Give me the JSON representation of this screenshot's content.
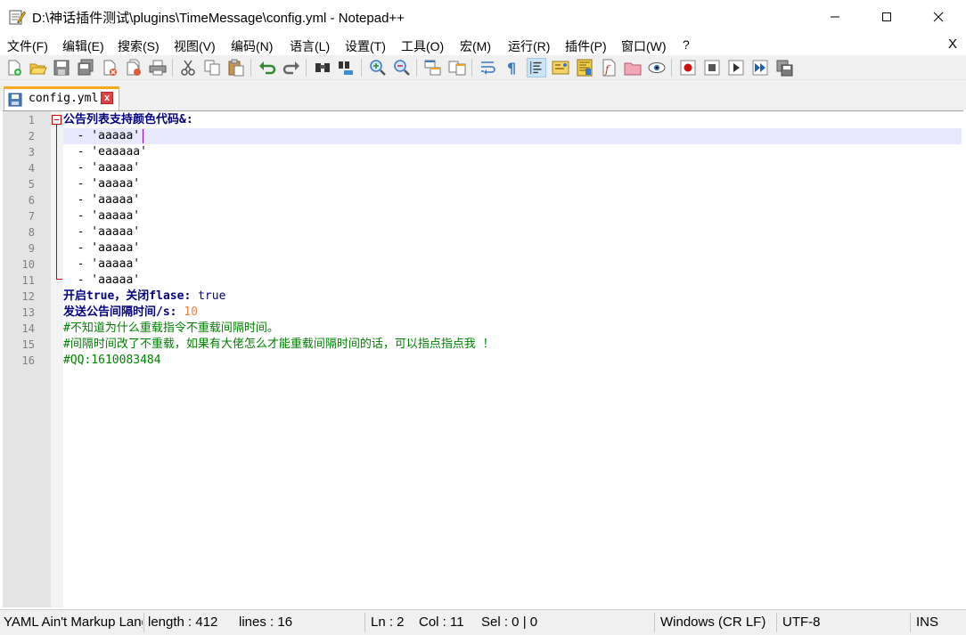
{
  "window": {
    "title": "D:\\神话插件测试\\plugins\\TimeMessage\\config.yml - Notepad++",
    "icon": "notepad-icon",
    "minimize_label": "─",
    "close_label": "✕"
  },
  "menu": {
    "items": [
      "文件(F)",
      "编辑(E)",
      "搜索(S)",
      "视图(V)",
      "编码(N)",
      "语言(L)",
      "设置(T)",
      "工具(O)",
      "宏(M)",
      "运行(R)",
      "插件(P)",
      "窗口(W)",
      "?"
    ],
    "close_label": "X"
  },
  "toolbar": {
    "icons": [
      "new-file-icon",
      "open-file-icon",
      "save-icon",
      "save-all-icon",
      "close-icon",
      "close-all-icon",
      "print-icon",
      "cut-icon",
      "copy-icon",
      "paste-icon",
      "undo-icon",
      "redo-icon",
      "find-icon",
      "replace-icon",
      "zoom-in-icon",
      "zoom-out-icon",
      "sync-vertical-icon",
      "sync-horizontal-icon",
      "word-wrap-icon",
      "show-all-chars-icon",
      "indent-guide-icon",
      "doc-map-icon",
      "function-list-icon",
      "folder-as-workspace-icon",
      "monitoring-icon",
      "record-macro-icon",
      "stop-record-icon",
      "play-macro-icon",
      "run-macro-multiple-icon",
      "save-macro-icon"
    ]
  },
  "tab": {
    "label": "config.yml",
    "close_label": "x"
  },
  "editor": {
    "lines": [
      {
        "num": "1",
        "parts": [
          {
            "cls": "k",
            "text": "公告列表支持颜色代码"
          },
          {
            "cls": "k",
            "text": "&:"
          }
        ]
      },
      {
        "num": "2",
        "parts": [
          {
            "cls": "s",
            "text": "  - 'aaaaa'"
          }
        ]
      },
      {
        "num": "3",
        "parts": [
          {
            "cls": "s",
            "text": "  - 'eaaaaa'"
          }
        ]
      },
      {
        "num": "4",
        "parts": [
          {
            "cls": "s",
            "text": "  - 'aaaaa'"
          }
        ]
      },
      {
        "num": "5",
        "parts": [
          {
            "cls": "s",
            "text": "  - 'aaaaa'"
          }
        ]
      },
      {
        "num": "6",
        "parts": [
          {
            "cls": "s",
            "text": "  - 'aaaaa'"
          }
        ]
      },
      {
        "num": "7",
        "parts": [
          {
            "cls": "s",
            "text": "  - 'aaaaa'"
          }
        ]
      },
      {
        "num": "8",
        "parts": [
          {
            "cls": "s",
            "text": "  - 'aaaaa'"
          }
        ]
      },
      {
        "num": "9",
        "parts": [
          {
            "cls": "s",
            "text": "  - 'aaaaa'"
          }
        ]
      },
      {
        "num": "10",
        "parts": [
          {
            "cls": "s",
            "text": "  - 'aaaaa'"
          }
        ]
      },
      {
        "num": "11",
        "parts": [
          {
            "cls": "s",
            "text": "  - 'aaaaa'"
          }
        ]
      },
      {
        "num": "12",
        "parts": [
          {
            "cls": "k",
            "text": "开启true，关闭flase:"
          },
          {
            "cls": "v",
            "text": " true"
          }
        ]
      },
      {
        "num": "13",
        "parts": [
          {
            "cls": "k",
            "text": "发送公告间隔时间/s:"
          },
          {
            "cls": "n",
            "text": " 10"
          }
        ]
      },
      {
        "num": "14",
        "parts": [
          {
            "cls": "c",
            "text": "#不知道为什么重载指令不重载间隔时间。"
          }
        ]
      },
      {
        "num": "15",
        "parts": [
          {
            "cls": "c",
            "text": "#间隔时间改了不重载，如果有大佬怎么才能重载间隔时间的话，可以指点指点我 ！"
          }
        ]
      },
      {
        "num": "16",
        "parts": [
          {
            "cls": "c",
            "text": "#QQ:1610083484"
          }
        ]
      }
    ],
    "current_line": 2
  },
  "status": {
    "language": "YAML Ain't Markup Language",
    "length": "length : 412",
    "lines": "lines : 16",
    "ln": "Ln : 2",
    "col": "Col : 11",
    "sel": "Sel : 0 | 0",
    "eol": "Windows (CR LF)",
    "encoding": "UTF-8",
    "mode": "INS"
  },
  "colors": {
    "keyword": "#000080",
    "number": "#ff8040",
    "comment": "#008000",
    "fold_marker": "#d00000",
    "tab_accent": "#f7a81b"
  }
}
